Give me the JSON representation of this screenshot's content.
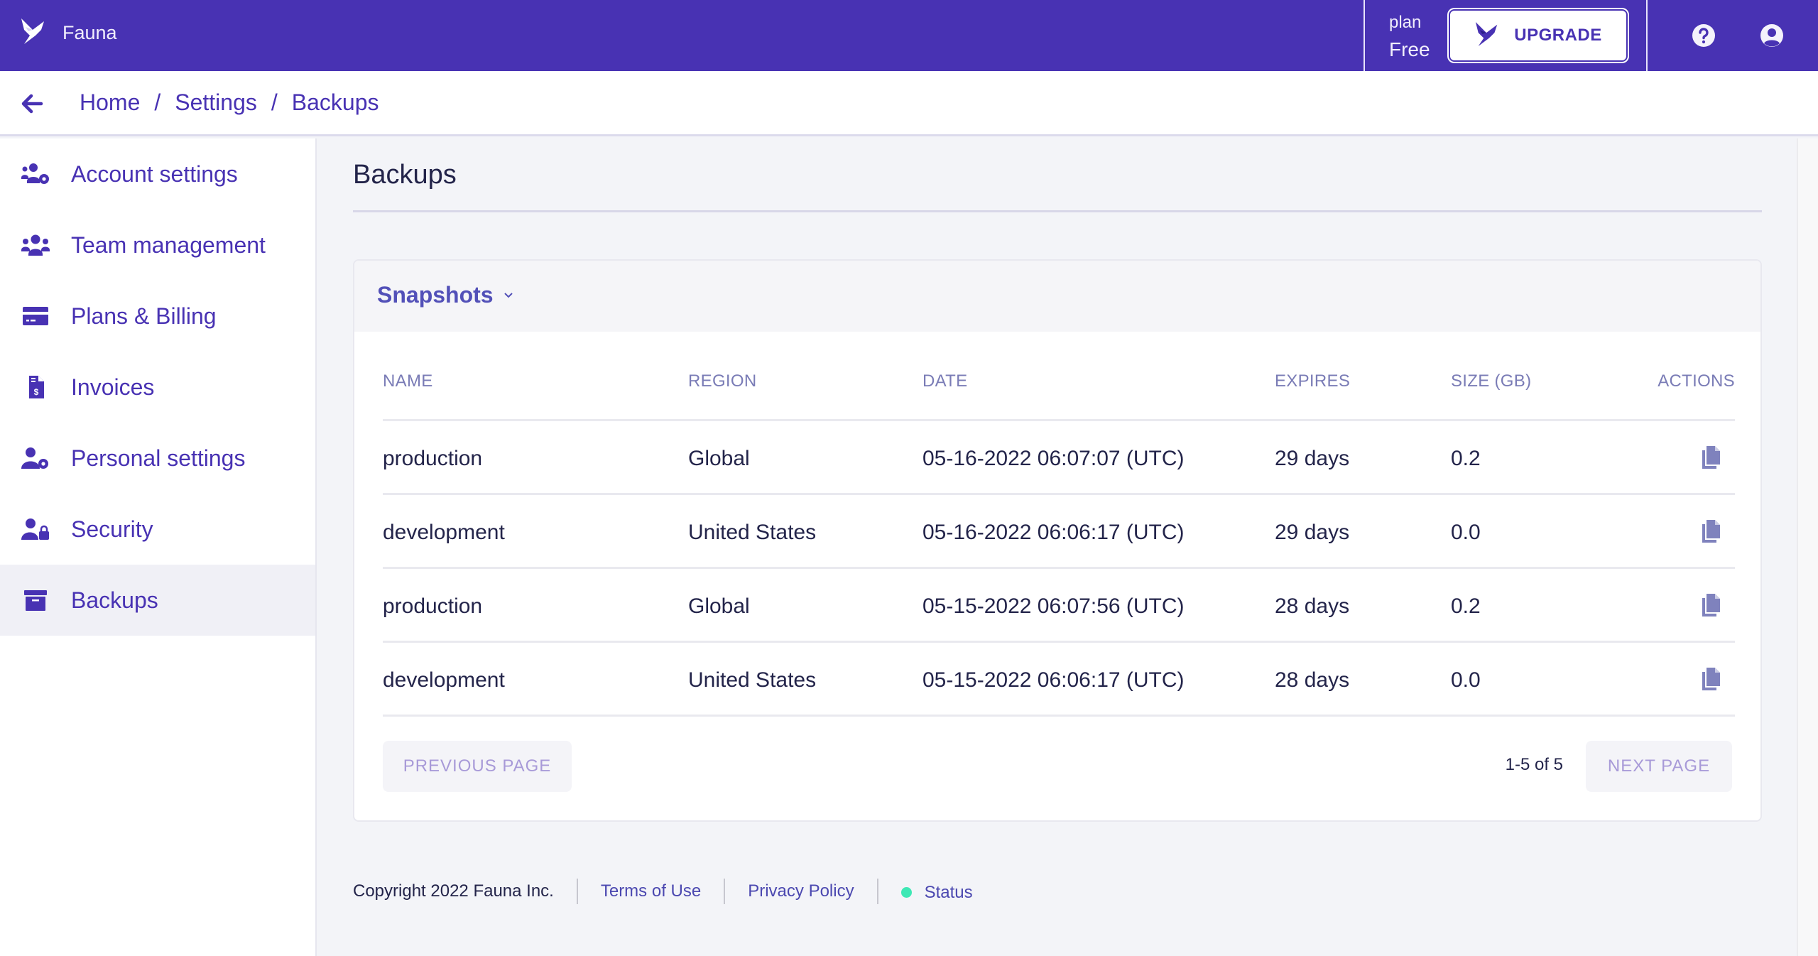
{
  "app": {
    "name": "Fauna",
    "brand_color": "#4832b3",
    "logo_icon": "fauna-bird-icon"
  },
  "header": {
    "plan_label": "plan",
    "plan_value": "Free",
    "upgrade_label": "UPGRADE",
    "help_icon": "help-circle-icon",
    "account_icon": "user-circle-icon"
  },
  "breadcrumb": {
    "back_icon": "arrow-left-icon",
    "items": [
      "Home",
      "Settings",
      "Backups"
    ],
    "separator": "/"
  },
  "sidebar": {
    "items": [
      {
        "label": "Account settings",
        "icon": "users-cog-icon",
        "active": false
      },
      {
        "label": "Team management",
        "icon": "users-icon",
        "active": false
      },
      {
        "label": "Plans & Billing",
        "icon": "credit-card-icon",
        "active": false
      },
      {
        "label": "Invoices",
        "icon": "invoice-dollar-icon",
        "active": false
      },
      {
        "label": "Personal settings",
        "icon": "user-cog-icon",
        "active": false
      },
      {
        "label": "Security",
        "icon": "user-lock-icon",
        "active": false
      },
      {
        "label": "Backups",
        "icon": "archive-box-icon",
        "active": true
      }
    ]
  },
  "main": {
    "title": "Backups",
    "section": {
      "label": "Snapshots",
      "toggle_icon": "chevron-down-icon"
    },
    "table": {
      "columns": [
        "NAME",
        "REGION",
        "DATE",
        "EXPIRES",
        "SIZE (GB)",
        "ACTIONS"
      ],
      "rows": [
        {
          "name": "production",
          "region": "Global",
          "date": "05-16-2022 06:07:07 (UTC)",
          "expires": "29 days",
          "size": "0.2",
          "action_icon": "copy-icon"
        },
        {
          "name": "development",
          "region": "United States",
          "date": "05-16-2022 06:06:17 (UTC)",
          "expires": "29 days",
          "size": "0.0",
          "action_icon": "copy-icon"
        },
        {
          "name": "production",
          "region": "Global",
          "date": "05-15-2022 06:07:56 (UTC)",
          "expires": "28 days",
          "size": "0.2",
          "action_icon": "copy-icon"
        },
        {
          "name": "development",
          "region": "United States",
          "date": "05-15-2022 06:06:17 (UTC)",
          "expires": "28 days",
          "size": "0.0",
          "action_icon": "copy-icon"
        }
      ]
    },
    "pagination": {
      "previous_label": "PREVIOUS PAGE",
      "next_label": "NEXT PAGE",
      "range_text": "1-5 of 5"
    }
  },
  "footer": {
    "copyright": "Copyright 2022 Fauna Inc.",
    "terms": "Terms of Use",
    "privacy": "Privacy Policy",
    "status": "Status",
    "status_color": "#3ee8b5"
  }
}
